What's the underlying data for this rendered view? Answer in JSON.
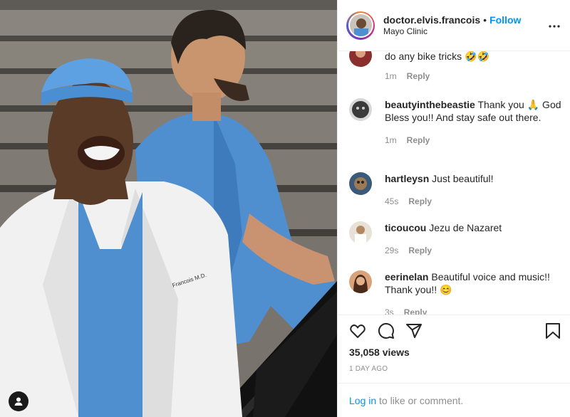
{
  "post": {
    "username": "doctor.elvis.francois",
    "separator": "•",
    "follow_label": "Follow",
    "location": "Mayo Clinic",
    "more_icon": "more-options-icon",
    "scrub_name_tag": "Francois M.D."
  },
  "comments": [
    {
      "user": "",
      "text": "do any bike tricks 🤣🤣",
      "time": "1m",
      "reply": "Reply"
    },
    {
      "user": "beautyinthebeastie",
      "text": "Thank you 🙏 God Bless you!! And stay safe out there.",
      "time": "1m",
      "reply": "Reply"
    },
    {
      "user": "hartleysn",
      "text": "Just beautiful!",
      "time": "45s",
      "reply": "Reply"
    },
    {
      "user": "ticoucou",
      "text": "Jezu de Nazaret",
      "time": "29s",
      "reply": "Reply"
    },
    {
      "user": "eerinelan",
      "text": "Beautiful voice and music!! Thank you!! 😊",
      "time": "3s",
      "reply": "Reply"
    }
  ],
  "stats": {
    "views": "35,058 views",
    "date": "1 DAY AGO"
  },
  "login": {
    "link": "Log in",
    "rest": " to like or comment."
  },
  "colors": {
    "accent": "#0095f6",
    "muted": "#8e8e8e",
    "text": "#262626"
  }
}
